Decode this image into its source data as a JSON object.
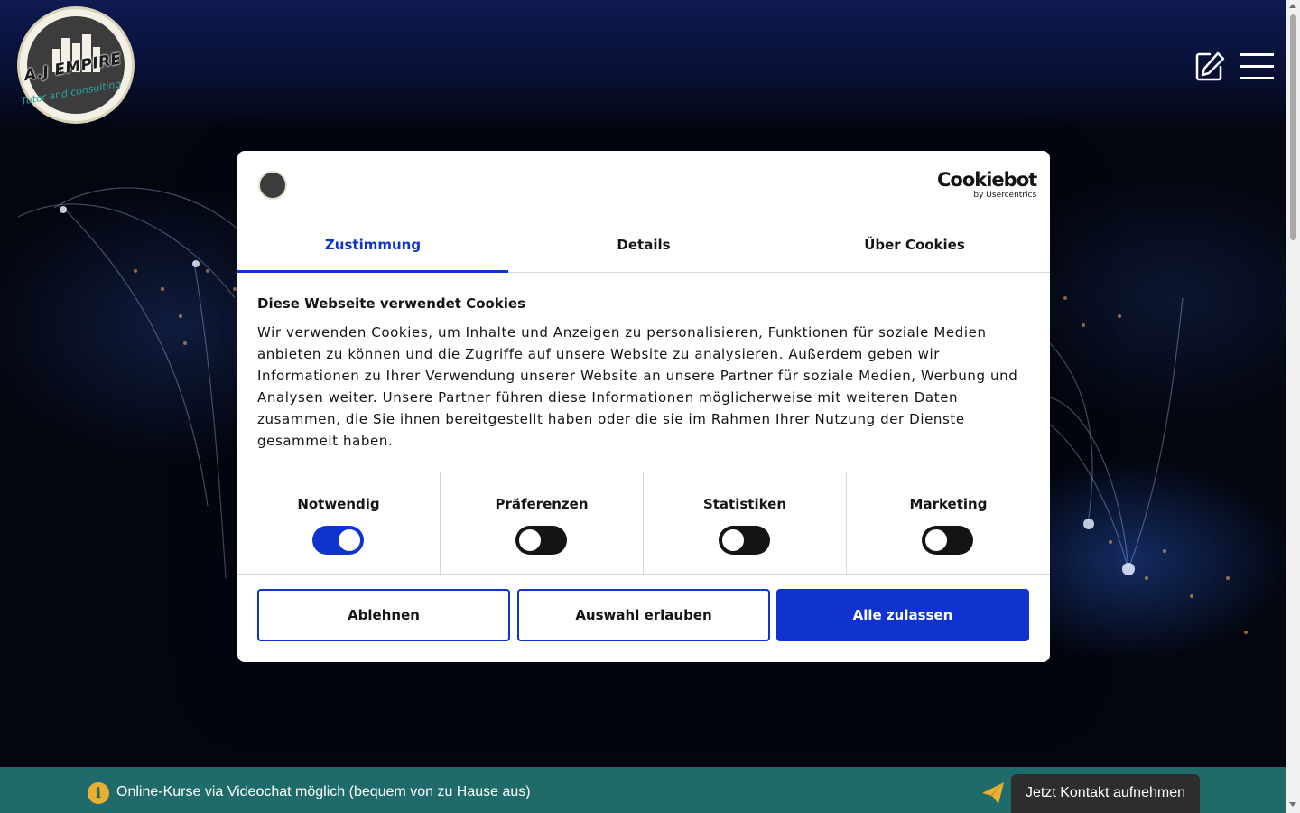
{
  "header": {
    "logo": {
      "brand": "A.J EMPIRE",
      "tagline": "Tutor and consulting"
    },
    "icons": {
      "edit": "edit-icon",
      "menu": "hamburger-menu-icon"
    }
  },
  "cookie_dialog": {
    "provider": {
      "name": "Cookiebot",
      "by": "by Usercentrics"
    },
    "tabs": [
      {
        "label": "Zustimmung",
        "active": true
      },
      {
        "label": "Details",
        "active": false
      },
      {
        "label": "Über Cookies",
        "active": false
      }
    ],
    "title": "Diese Webseite verwendet Cookies",
    "body": "Wir verwenden Cookies, um Inhalte und Anzeigen zu personalisieren, Funktionen für soziale Medien anbieten zu können und die Zugriffe auf unsere Website zu analysieren. Außerdem geben wir Informationen zu Ihrer Verwendung unserer Website an unsere Partner für soziale Medien, Werbung und Analysen weiter. Unsere Partner führen diese Informationen möglicherweise mit weiteren Daten zusammen, die Sie ihnen bereitgestellt haben oder die sie im Rahmen Ihrer Nutzung der Dienste gesammelt haben.",
    "categories": [
      {
        "label": "Notwendig",
        "enabled": true
      },
      {
        "label": "Präferenzen",
        "enabled": false
      },
      {
        "label": "Statistiken",
        "enabled": false
      },
      {
        "label": "Marketing",
        "enabled": false
      }
    ],
    "buttons": {
      "decline": "Ablehnen",
      "allow_selection": "Auswahl erlauben",
      "allow_all": "Alle zulassen"
    },
    "colors": {
      "accent": "#1032cf",
      "text": "#141414"
    }
  },
  "info_bar": {
    "text": "Online-Kurse via Videochat möglich (bequem von zu Hause aus)",
    "contact_button": "Jetzt Kontakt aufnehmen",
    "background": "#1f6b6b",
    "icon_color": "#e8b02e"
  }
}
